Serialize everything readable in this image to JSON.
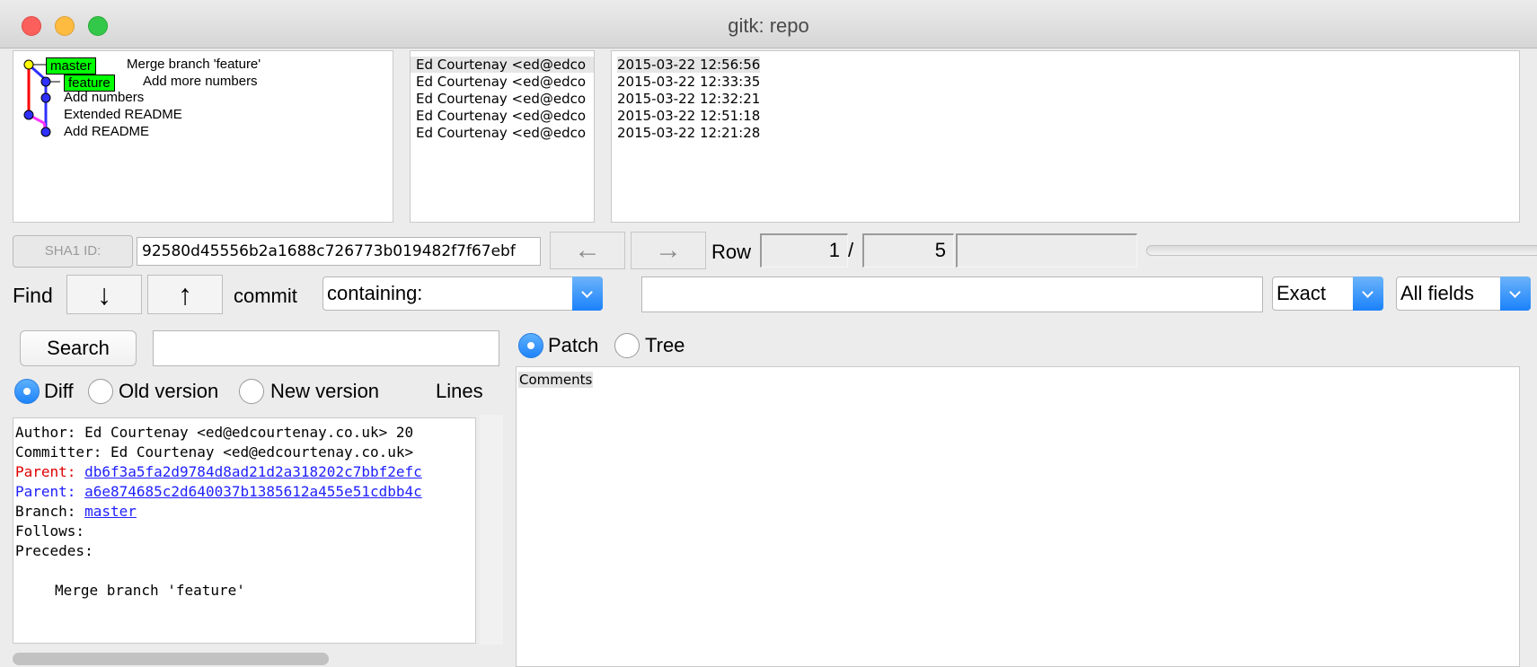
{
  "window": {
    "title": "gitk: repo"
  },
  "commits": [
    {
      "message": "Merge branch 'feature'",
      "author": "Ed Courtenay <ed@edco",
      "date": "2015-03-22 12:56:56",
      "ref": "master"
    },
    {
      "message": "Add more numbers",
      "author": "Ed Courtenay <ed@edco",
      "date": "2015-03-22 12:33:35",
      "ref": "feature"
    },
    {
      "message": "Add numbers",
      "author": "Ed Courtenay <ed@edco",
      "date": "2015-03-22 12:32:21"
    },
    {
      "message": "Extended README",
      "author": "Ed Courtenay <ed@edco",
      "date": "2015-03-22 12:51:18"
    },
    {
      "message": "Add README",
      "author": "Ed Courtenay <ed@edco",
      "date": "2015-03-22 12:21:28"
    }
  ],
  "colors": {
    "ref_tag": "#00ff00",
    "graph_red": "#ff0000",
    "graph_blue": "#3030ff",
    "graph_magenta": "#ff33ff",
    "accent": "#1f84fb"
  },
  "toolbar": {
    "sha1_label": "SHA1 ID:",
    "sha1_value": "92580d45556b2a1688c726773b019482f7f67ebf",
    "back_icon": "left-arrow-icon",
    "forward_icon": "right-arrow-icon",
    "row_label": "Row",
    "row_current": "1",
    "row_separator": "/",
    "row_total": "5"
  },
  "find": {
    "label": "Find",
    "down_icon": "↓",
    "up_icon": "↑",
    "commit_label": "commit",
    "type_value": "containing:",
    "match_value": "Exact",
    "field_value": "All fields"
  },
  "search": {
    "button_label": "Search"
  },
  "view_mode": {
    "patch_label": "Patch",
    "tree_label": "Tree",
    "selected": "Patch"
  },
  "diff_mode": {
    "diff_label": "Diff",
    "old_label": "Old version",
    "new_label": "New version",
    "lines_label": "Lines",
    "selected": "Diff"
  },
  "details": {
    "author_line": "Author: Ed Courtenay <ed@edcourtenay.co.uk>  20",
    "committer_line": "Committer: Ed Courtenay <ed@edcourtenay.co.uk>",
    "parent_label": "Parent:",
    "parent1_sha": "db6f3a5fa2d9784d8ad21d2a318202c7bbf2efc",
    "parent2_sha": "a6e874685c2d640037b1385612a455e51cdbb4c",
    "branch_label": "Branch:",
    "branch_value": "master",
    "follows_label": "Follows:",
    "precedes_label": "Precedes:",
    "message": "Merge branch 'feature'"
  },
  "files": {
    "comments_label": "Comments"
  }
}
